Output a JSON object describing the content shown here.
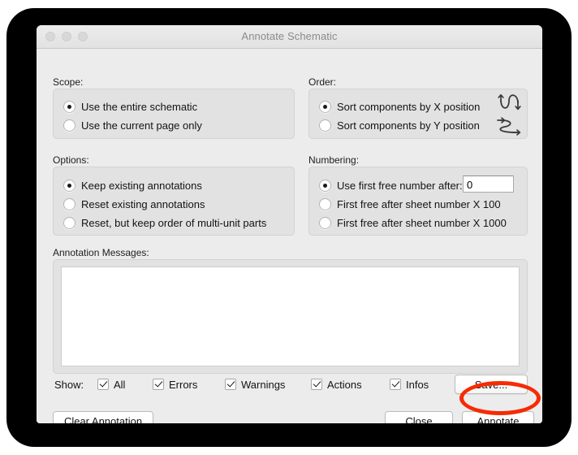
{
  "window": {
    "title": "Annotate Schematic",
    "traffic_lights": [
      "close-button",
      "minimize-button",
      "zoom-button"
    ]
  },
  "scope": {
    "label": "Scope:",
    "options": [
      {
        "label": "Use the entire schematic",
        "checked": true
      },
      {
        "label": "Use the current page only",
        "checked": false
      }
    ]
  },
  "order": {
    "label": "Order:",
    "options": [
      {
        "label": "Sort components by X position",
        "checked": true,
        "icon": "serpentine-vertical-icon"
      },
      {
        "label": "Sort components by Y position",
        "checked": false,
        "icon": "serpentine-horizontal-icon"
      }
    ]
  },
  "options": {
    "label": "Options:",
    "choices": [
      {
        "label": "Keep existing annotations",
        "checked": true
      },
      {
        "label": "Reset existing annotations",
        "checked": false
      },
      {
        "label": "Reset, but keep order of multi-unit parts",
        "checked": false
      }
    ]
  },
  "numbering": {
    "label": "Numbering:",
    "choices": [
      {
        "label": "Use first free number after:",
        "checked": true
      },
      {
        "label": "First free after sheet number X 100",
        "checked": false
      },
      {
        "label": "First free after sheet number X 1000",
        "checked": false
      }
    ],
    "first_free_number_value": "0",
    "first_free_number_placeholder": ""
  },
  "messages": {
    "label": "Annotation Messages:",
    "content": ""
  },
  "show": {
    "label": "Show:",
    "filters": [
      {
        "label": "All",
        "checked": true
      },
      {
        "label": "Errors",
        "checked": true
      },
      {
        "label": "Warnings",
        "checked": true
      },
      {
        "label": "Actions",
        "checked": true
      },
      {
        "label": "Infos",
        "checked": true
      }
    ],
    "save_label": "Save..."
  },
  "footer": {
    "clear_label": "Clear Annotation",
    "close_label": "Close",
    "annotate_label": "Annotate"
  },
  "annotation": {
    "highlight_color": "#f62b00",
    "highlight_target": "Annotate"
  }
}
